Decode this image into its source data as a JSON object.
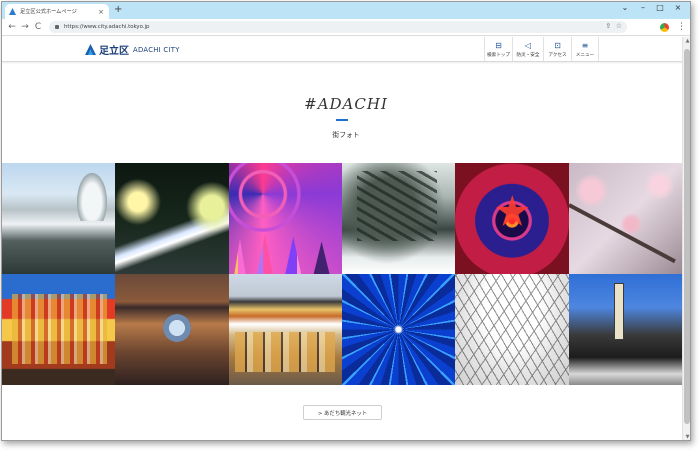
{
  "browser": {
    "tab_title": "足立区公式ホームページ",
    "tab_close": "×",
    "new_tab": "+",
    "url": "https://www.city.adachi.tokyo.jp",
    "window_controls": [
      "⌄",
      "–",
      "□",
      "×"
    ],
    "nav": {
      "back": "←",
      "forward": "→",
      "reload": "C"
    },
    "omnibox_icons": [
      "⇪",
      "☆"
    ],
    "menu": "⋮"
  },
  "site_header": {
    "logo_jp": "足立区",
    "logo_en": "ADACHI CITY",
    "nav": [
      {
        "label": "検索トップ",
        "icon": "search-list-icon",
        "glyph": "⊟"
      },
      {
        "label": "防災・安全",
        "icon": "megaphone-icon",
        "glyph": "◁"
      },
      {
        "label": "アクセス",
        "icon": "bus-icon",
        "glyph": "⊡"
      },
      {
        "label": "メニュー",
        "icon": "hamburger-icon",
        "glyph": "≡"
      }
    ]
  },
  "hero": {
    "hashtag": "#ADACHI",
    "subtitle": "街フォト"
  },
  "photos": [
    "snow-garden",
    "light-trails",
    "ferris-wheel-illumination",
    "snowy-pine",
    "red-star-light",
    "plum-blossoms",
    "festival-rakes",
    "shrine-carving",
    "monks-procession",
    "blue-illumination",
    "bare-trees",
    "festival-procession"
  ],
  "footer_button": {
    "label": "> あだち観光ネット"
  },
  "colors": {
    "accent": "#1d6fd0",
    "titlebar": "#bde3f6",
    "brand": "#1b3f7a"
  }
}
